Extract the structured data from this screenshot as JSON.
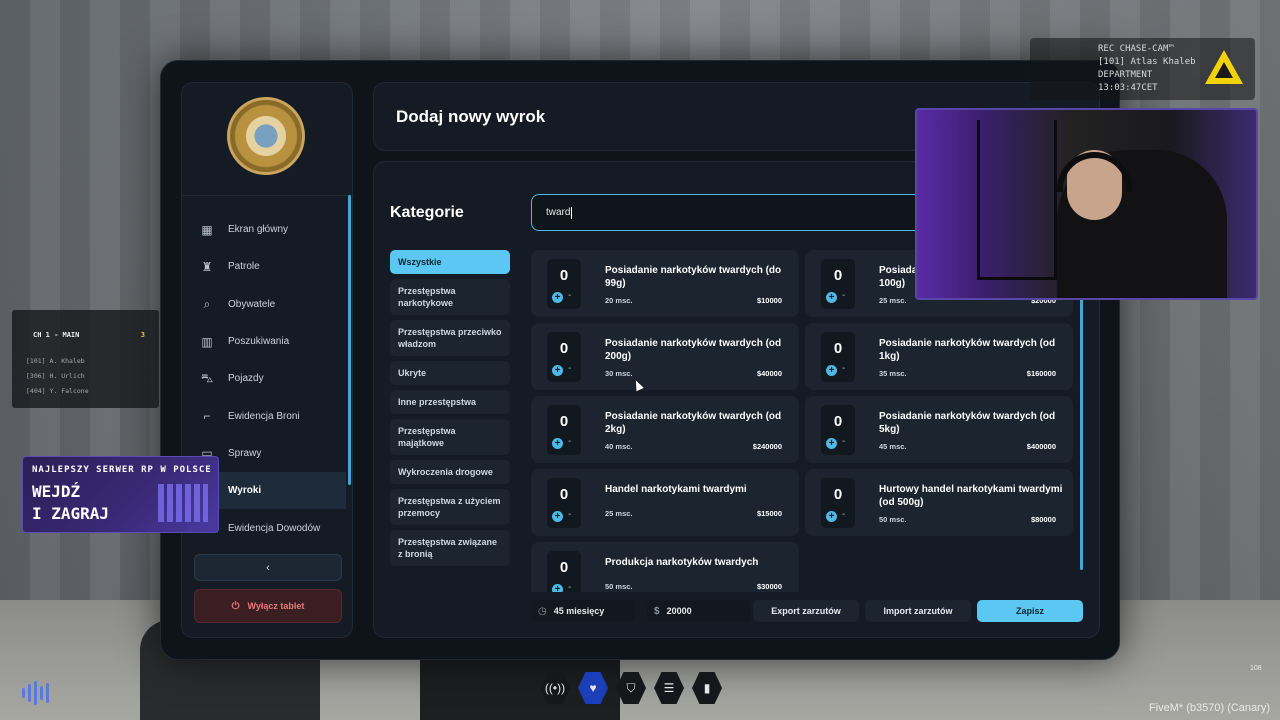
{
  "cam_hud": {
    "lines": [
      "REC   CHASE-CAM™",
      "[101] Atlas Khaleb",
      "DEPARTMENT",
      "13:03:47CET"
    ]
  },
  "tablet": {
    "sidebar": {
      "items": [
        {
          "label": "Ekran główny",
          "icon": "grid-icon"
        },
        {
          "label": "Patrole",
          "icon": "officer-icon"
        },
        {
          "label": "Obywatele",
          "icon": "search-icon"
        },
        {
          "label": "Poszukiwania",
          "icon": "jail-icon"
        },
        {
          "label": "Pojazdy",
          "icon": "car-icon"
        },
        {
          "label": "Ewidencja Broni",
          "icon": "gun-icon"
        },
        {
          "label": "Sprawy",
          "icon": "folder-icon"
        },
        {
          "label": "Wyroki",
          "icon": "gavel-icon"
        },
        {
          "label": "Ewidencja Dowodów",
          "icon": "evidence-icon"
        }
      ],
      "back_label": "‹",
      "power_label": "Wyłącz tablet"
    },
    "header_title": "Dodaj nowy wyrok",
    "categories_title": "Kategorie",
    "categories": [
      "Wszystkie",
      "Przestępstwa narkotykowe",
      "Przestępstwa przeciwko władzom",
      "Ukryte",
      "Inne przestępstwa",
      "Przestępstwa majątkowe",
      "Wykroczenia drogowe",
      "Przestępstwa z użyciem przemocy",
      "Przestępstwa związane z bronią"
    ],
    "search_value": "tward",
    "charges": [
      {
        "qty": "0",
        "name": "Posiadanie narkotyków twardych (do 99g)",
        "months": "20 msc.",
        "price": "$10000"
      },
      {
        "qty": "0",
        "name": "Posiadanie narkotyków twardych (od 100g)",
        "months": "25 msc.",
        "price": "$20000"
      },
      {
        "qty": "0",
        "name": "Posiadanie narkotyków twardych (od 200g)",
        "months": "30 msc.",
        "price": "$40000"
      },
      {
        "qty": "0",
        "name": "Posiadanie narkotyków twardych (od 1kg)",
        "months": "35 msc.",
        "price": "$160000"
      },
      {
        "qty": "0",
        "name": "Posiadanie narkotyków twardych (od 2kg)",
        "months": "40 msc.",
        "price": "$240000"
      },
      {
        "qty": "0",
        "name": "Posiadanie narkotyków twardych (od 5kg)",
        "months": "45 msc.",
        "price": "$400000"
      },
      {
        "qty": "0",
        "name": "Handel narkotykami twardymi",
        "months": "25 msc.",
        "price": "$15000"
      },
      {
        "qty": "0",
        "name": "Hurtowy handel narkotykami twardymi (od 500g)",
        "months": "50 msc.",
        "price": "$80000"
      },
      {
        "qty": "0",
        "name": "Produkcja narkotyków twardych",
        "months": "50 msc.",
        "price": "$30000"
      }
    ],
    "footer": {
      "months_total": "45 miesięcy",
      "fine_total": "20000",
      "export_label": "Export zarzutów",
      "import_label": "Import zarzutów",
      "save_label": "Zapisz"
    }
  },
  "radio": {
    "channel": "CH 1 - MAIN",
    "count": "3",
    "members": [
      "[101] A. Khaleb",
      "[306] H. Urlich",
      "[404] Y. Falcone"
    ]
  },
  "promo": {
    "top": "NAJLEPSZY SERWER RP W POLSCE",
    "line1": "WEJDŹ",
    "line2": "I ZAGRAJ"
  },
  "fps": "108",
  "fivem_label": "FiveM* (b3570) (Canary)"
}
